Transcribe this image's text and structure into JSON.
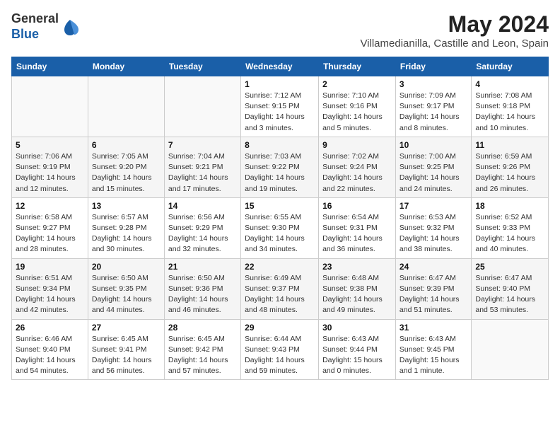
{
  "logo": {
    "general": "General",
    "blue": "Blue"
  },
  "title": {
    "month_year": "May 2024",
    "location": "Villamedianilla, Castille and Leon, Spain"
  },
  "headers": [
    "Sunday",
    "Monday",
    "Tuesday",
    "Wednesday",
    "Thursday",
    "Friday",
    "Saturday"
  ],
  "weeks": [
    [
      {
        "day": "",
        "info": ""
      },
      {
        "day": "",
        "info": ""
      },
      {
        "day": "",
        "info": ""
      },
      {
        "day": "1",
        "info": "Sunrise: 7:12 AM\nSunset: 9:15 PM\nDaylight: 14 hours\nand 3 minutes."
      },
      {
        "day": "2",
        "info": "Sunrise: 7:10 AM\nSunset: 9:16 PM\nDaylight: 14 hours\nand 5 minutes."
      },
      {
        "day": "3",
        "info": "Sunrise: 7:09 AM\nSunset: 9:17 PM\nDaylight: 14 hours\nand 8 minutes."
      },
      {
        "day": "4",
        "info": "Sunrise: 7:08 AM\nSunset: 9:18 PM\nDaylight: 14 hours\nand 10 minutes."
      }
    ],
    [
      {
        "day": "5",
        "info": "Sunrise: 7:06 AM\nSunset: 9:19 PM\nDaylight: 14 hours\nand 12 minutes."
      },
      {
        "day": "6",
        "info": "Sunrise: 7:05 AM\nSunset: 9:20 PM\nDaylight: 14 hours\nand 15 minutes."
      },
      {
        "day": "7",
        "info": "Sunrise: 7:04 AM\nSunset: 9:21 PM\nDaylight: 14 hours\nand 17 minutes."
      },
      {
        "day": "8",
        "info": "Sunrise: 7:03 AM\nSunset: 9:22 PM\nDaylight: 14 hours\nand 19 minutes."
      },
      {
        "day": "9",
        "info": "Sunrise: 7:02 AM\nSunset: 9:24 PM\nDaylight: 14 hours\nand 22 minutes."
      },
      {
        "day": "10",
        "info": "Sunrise: 7:00 AM\nSunset: 9:25 PM\nDaylight: 14 hours\nand 24 minutes."
      },
      {
        "day": "11",
        "info": "Sunrise: 6:59 AM\nSunset: 9:26 PM\nDaylight: 14 hours\nand 26 minutes."
      }
    ],
    [
      {
        "day": "12",
        "info": "Sunrise: 6:58 AM\nSunset: 9:27 PM\nDaylight: 14 hours\nand 28 minutes."
      },
      {
        "day": "13",
        "info": "Sunrise: 6:57 AM\nSunset: 9:28 PM\nDaylight: 14 hours\nand 30 minutes."
      },
      {
        "day": "14",
        "info": "Sunrise: 6:56 AM\nSunset: 9:29 PM\nDaylight: 14 hours\nand 32 minutes."
      },
      {
        "day": "15",
        "info": "Sunrise: 6:55 AM\nSunset: 9:30 PM\nDaylight: 14 hours\nand 34 minutes."
      },
      {
        "day": "16",
        "info": "Sunrise: 6:54 AM\nSunset: 9:31 PM\nDaylight: 14 hours\nand 36 minutes."
      },
      {
        "day": "17",
        "info": "Sunrise: 6:53 AM\nSunset: 9:32 PM\nDaylight: 14 hours\nand 38 minutes."
      },
      {
        "day": "18",
        "info": "Sunrise: 6:52 AM\nSunset: 9:33 PM\nDaylight: 14 hours\nand 40 minutes."
      }
    ],
    [
      {
        "day": "19",
        "info": "Sunrise: 6:51 AM\nSunset: 9:34 PM\nDaylight: 14 hours\nand 42 minutes."
      },
      {
        "day": "20",
        "info": "Sunrise: 6:50 AM\nSunset: 9:35 PM\nDaylight: 14 hours\nand 44 minutes."
      },
      {
        "day": "21",
        "info": "Sunrise: 6:50 AM\nSunset: 9:36 PM\nDaylight: 14 hours\nand 46 minutes."
      },
      {
        "day": "22",
        "info": "Sunrise: 6:49 AM\nSunset: 9:37 PM\nDaylight: 14 hours\nand 48 minutes."
      },
      {
        "day": "23",
        "info": "Sunrise: 6:48 AM\nSunset: 9:38 PM\nDaylight: 14 hours\nand 49 minutes."
      },
      {
        "day": "24",
        "info": "Sunrise: 6:47 AM\nSunset: 9:39 PM\nDaylight: 14 hours\nand 51 minutes."
      },
      {
        "day": "25",
        "info": "Sunrise: 6:47 AM\nSunset: 9:40 PM\nDaylight: 14 hours\nand 53 minutes."
      }
    ],
    [
      {
        "day": "26",
        "info": "Sunrise: 6:46 AM\nSunset: 9:40 PM\nDaylight: 14 hours\nand 54 minutes."
      },
      {
        "day": "27",
        "info": "Sunrise: 6:45 AM\nSunset: 9:41 PM\nDaylight: 14 hours\nand 56 minutes."
      },
      {
        "day": "28",
        "info": "Sunrise: 6:45 AM\nSunset: 9:42 PM\nDaylight: 14 hours\nand 57 minutes."
      },
      {
        "day": "29",
        "info": "Sunrise: 6:44 AM\nSunset: 9:43 PM\nDaylight: 14 hours\nand 59 minutes."
      },
      {
        "day": "30",
        "info": "Sunrise: 6:43 AM\nSunset: 9:44 PM\nDaylight: 15 hours\nand 0 minutes."
      },
      {
        "day": "31",
        "info": "Sunrise: 6:43 AM\nSunset: 9:45 PM\nDaylight: 15 hours\nand 1 minute."
      },
      {
        "day": "",
        "info": ""
      }
    ]
  ]
}
